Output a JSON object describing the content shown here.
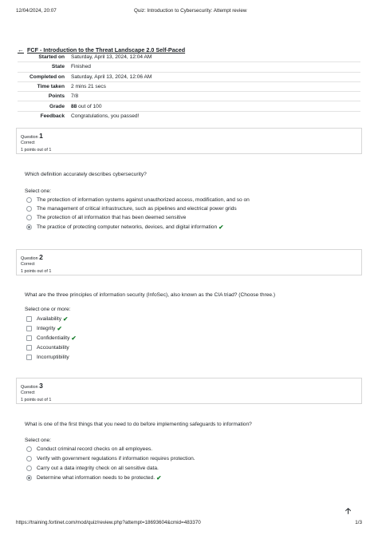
{
  "print_header": {
    "datetime": "12/04/2024, 20:07",
    "title": "Quiz: Introduction to Cybersecurity: Attempt review"
  },
  "back_link": "FCF - Introduction to the Threat Landscape 2.0 Self-Paced",
  "summary": [
    {
      "label": "Started on",
      "value": "Saturday, April 13, 2024, 12:04 AM"
    },
    {
      "label": "State",
      "value": "Finished"
    },
    {
      "label": "Completed on",
      "value": "Saturday, April 13, 2024, 12:06 AM"
    },
    {
      "label": "Time taken",
      "value": "2 mins 21 secs"
    },
    {
      "label": "Points",
      "value": "7/8"
    },
    {
      "label": "Grade",
      "value_bold": "88",
      "value_rest": " out of 100"
    },
    {
      "label": "Feedback",
      "value": "Congratulations, you passed!"
    }
  ],
  "questions": [
    {
      "prefix": "Question",
      "number": "1",
      "state": "Correct",
      "points": "1 points out of 1",
      "text": "Which definition accurately describes cybersecurity?",
      "select_label": "Select one:",
      "options": [
        "The protection of information systems against unauthorized access, modification, and so on",
        "The management of critical infrastructure, such as pipelines and electrical power grids",
        "The protection of all information that has been deemed sensitive",
        "The practice of protecting computer networks, devices, and digital information"
      ]
    },
    {
      "prefix": "Question",
      "number": "2",
      "state": "Correct",
      "points": "1 points out of 1",
      "text": "What are the three principles of information security (InfoSec), also known as the CIA triad? (Choose three.)",
      "select_label": "Select one or more:",
      "options": [
        "Availability",
        "Integrity",
        "Confidentiality",
        "Accountability",
        "Incorruptibility"
      ]
    },
    {
      "prefix": "Question",
      "number": "3",
      "state": "Correct",
      "points": "1 points out of 1",
      "text": "What is one of the first things that you need to do before implementing safeguards to information?",
      "select_label": "Select one:",
      "options": [
        "Conduct criminal record checks on all employees.",
        "Verify with government regulations if information requires protection.",
        "Carry out a data integrity check on all sensitive data.",
        "Determine what information needs to be protected."
      ]
    }
  ],
  "print_footer": {
    "url": "https://training.fortinet.com/mod/quiz/review.php?attempt=18693604&cmid=483370",
    "page": "1/3"
  },
  "colors": {
    "correct_tick": "#1a7f2e",
    "border": "#d7d7d7"
  },
  "icons": {
    "correct": "check-mark-icon",
    "back": "arrow-left-icon",
    "top": "arrow-up-icon"
  }
}
